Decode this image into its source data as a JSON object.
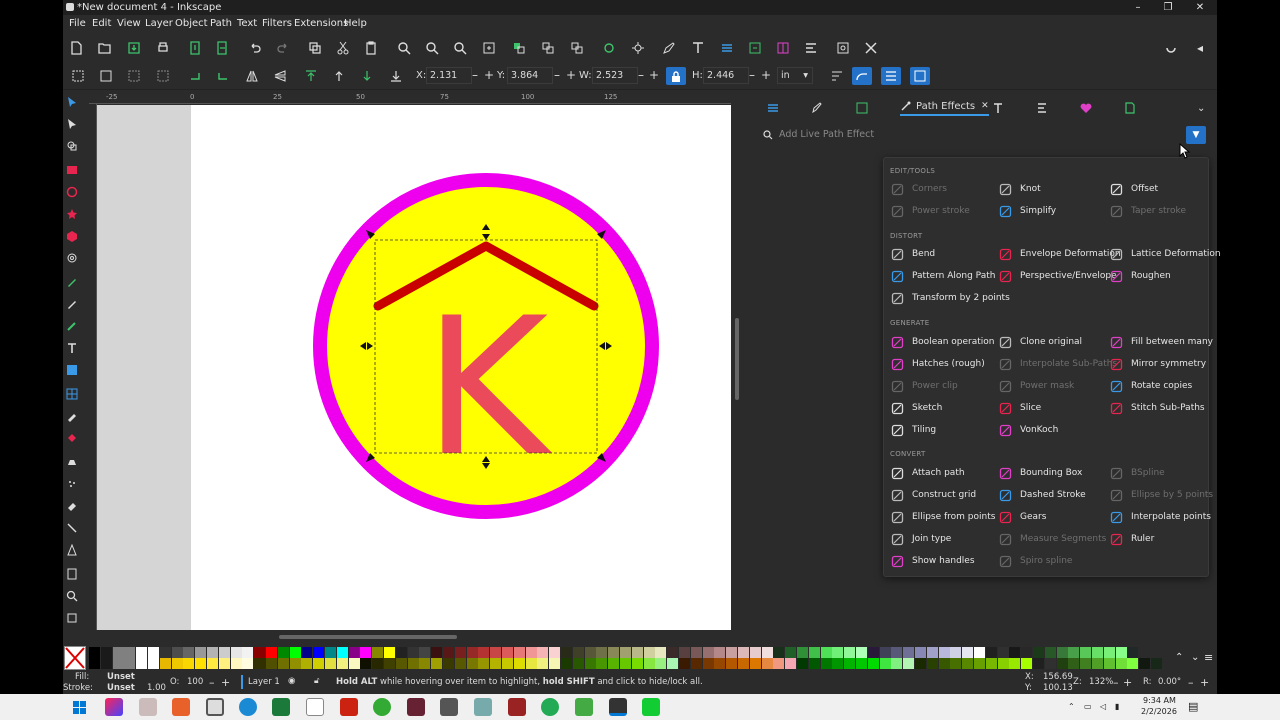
{
  "window": {
    "title": "*New document 4 - Inkscape",
    "min": "–",
    "max": "❐",
    "close": "✕"
  },
  "menu": [
    "File",
    "Edit",
    "View",
    "Layer",
    "Object",
    "Path",
    "Text",
    "Filters",
    "Extensions",
    "Help"
  ],
  "controls": {
    "x_label": "X:",
    "x_value": "2.131",
    "y_label": "Y:",
    "y_value": "3.864",
    "w_label": "W:",
    "w_value": "2.523",
    "h_label": "H:",
    "h_value": "2.446",
    "unit": "in"
  },
  "ruler": {
    "h_ticks": [
      "-25",
      "0",
      "25",
      "50",
      "75",
      "100",
      "125"
    ],
    "v_ticks": [
      "0",
      "25",
      "50",
      "75",
      "100"
    ]
  },
  "canvas": {
    "letter": "K",
    "colors": {
      "ring": "#ee00ee",
      "fill": "#ffff00",
      "roof": "#c80000",
      "letter": "#ea4a5a"
    }
  },
  "dock": {
    "active_tab": "Path Effects",
    "tab_close": "✕",
    "search_placeholder": "Add Live Path Effect"
  },
  "effects": {
    "categories": {
      "edit_tools": "EDIT/TOOLS",
      "distort": "DISTORT",
      "generate": "GENERATE",
      "convert": "CONVERT"
    },
    "edit_tools": [
      {
        "label": "Corners",
        "disabled": true,
        "icon": "corners-icon"
      },
      {
        "label": "Knot",
        "disabled": false,
        "icon": "knot-icon"
      },
      {
        "label": "Offset",
        "disabled": false,
        "icon": "offset-icon"
      },
      {
        "label": "Power stroke",
        "disabled": true,
        "icon": "power-stroke-icon"
      },
      {
        "label": "Simplify",
        "disabled": false,
        "icon": "simplify-icon"
      },
      {
        "label": "Taper stroke",
        "disabled": true,
        "icon": "taper-stroke-icon"
      }
    ],
    "distort": [
      {
        "label": "Bend",
        "disabled": false,
        "icon": "bend-icon"
      },
      {
        "label": "Envelope Deformation",
        "disabled": false,
        "icon": "envelope-deformation-icon"
      },
      {
        "label": "Lattice Deformation",
        "disabled": false,
        "icon": "lattice-deformation-icon"
      },
      {
        "label": "Pattern Along Path",
        "disabled": false,
        "icon": "pattern-along-path-icon"
      },
      {
        "label": "Perspective/Envelope",
        "disabled": false,
        "icon": "perspective-envelope-icon"
      },
      {
        "label": "Roughen",
        "disabled": false,
        "icon": "roughen-icon"
      },
      {
        "label": "Transform by 2 points",
        "disabled": false,
        "icon": "transform-2pts-icon"
      }
    ],
    "generate": [
      {
        "label": "Boolean operation",
        "disabled": false,
        "icon": "boolean-operation-icon"
      },
      {
        "label": "Clone original",
        "disabled": false,
        "icon": "clone-original-icon"
      },
      {
        "label": "Fill between many",
        "disabled": false,
        "icon": "fill-between-many-icon"
      },
      {
        "label": "Hatches (rough)",
        "disabled": false,
        "icon": "hatches-icon"
      },
      {
        "label": "Interpolate Sub-Paths",
        "disabled": true,
        "icon": "interpolate-subpaths-icon"
      },
      {
        "label": "Mirror symmetry",
        "disabled": false,
        "icon": "mirror-symmetry-icon"
      },
      {
        "label": "Power clip",
        "disabled": true,
        "icon": "power-clip-icon"
      },
      {
        "label": "Power mask",
        "disabled": true,
        "icon": "power-mask-icon"
      },
      {
        "label": "Rotate copies",
        "disabled": false,
        "icon": "rotate-copies-icon"
      },
      {
        "label": "Sketch",
        "disabled": false,
        "icon": "sketch-icon"
      },
      {
        "label": "Slice",
        "disabled": false,
        "icon": "slice-icon"
      },
      {
        "label": "Stitch Sub-Paths",
        "disabled": false,
        "icon": "stitch-subpaths-icon"
      },
      {
        "label": "Tiling",
        "disabled": false,
        "icon": "tiling-icon"
      },
      {
        "label": "VonKoch",
        "disabled": false,
        "icon": "vonkoch-icon"
      }
    ],
    "convert": [
      {
        "label": "Attach path",
        "disabled": false,
        "icon": "attach-path-icon"
      },
      {
        "label": "Bounding Box",
        "disabled": false,
        "icon": "bounding-box-icon"
      },
      {
        "label": "BSpline",
        "disabled": true,
        "icon": "bspline-icon"
      },
      {
        "label": "Construct grid",
        "disabled": false,
        "icon": "construct-grid-icon"
      },
      {
        "label": "Dashed Stroke",
        "disabled": false,
        "icon": "dashed-stroke-icon"
      },
      {
        "label": "Ellipse by 5 points",
        "disabled": true,
        "icon": "ellipse-5pts-icon"
      },
      {
        "label": "Ellipse from points",
        "disabled": false,
        "icon": "ellipse-from-points-icon"
      },
      {
        "label": "Gears",
        "disabled": false,
        "icon": "gears-icon"
      },
      {
        "label": "Interpolate points",
        "disabled": false,
        "icon": "interpolate-points-icon"
      },
      {
        "label": "Join type",
        "disabled": false,
        "icon": "join-type-icon"
      },
      {
        "label": "Measure Segments",
        "disabled": true,
        "icon": "measure-segments-icon"
      },
      {
        "label": "Ruler",
        "disabled": false,
        "icon": "ruler-icon"
      },
      {
        "label": "Show handles",
        "disabled": false,
        "icon": "show-handles-icon"
      },
      {
        "label": "Spiro spline",
        "disabled": true,
        "icon": "spiro-spline-icon"
      }
    ]
  },
  "status": {
    "fill_label": "Fill:",
    "fill_value": "Unset",
    "stroke_label": "Stroke:",
    "stroke_value": "Unset",
    "stroke_width": "1.00",
    "opacity_label": "O:",
    "opacity_value": "100",
    "layer": "Layer 1",
    "message_b1": "Hold ALT",
    "message_m1": " while hovering over item to highlight, ",
    "message_b2": "hold SHIFT",
    "message_m2": " and click to hide/lock all.",
    "x_label": "X:",
    "x_value": "156.69",
    "y_label": "Y:",
    "y_value": "100.13",
    "zoom_label": "Z:",
    "zoom_value": "132%",
    "rot_label": "R:",
    "rot_value": "0.00°"
  },
  "taskbar": {
    "time": "9:34 AM",
    "date": "2/2/2026"
  }
}
